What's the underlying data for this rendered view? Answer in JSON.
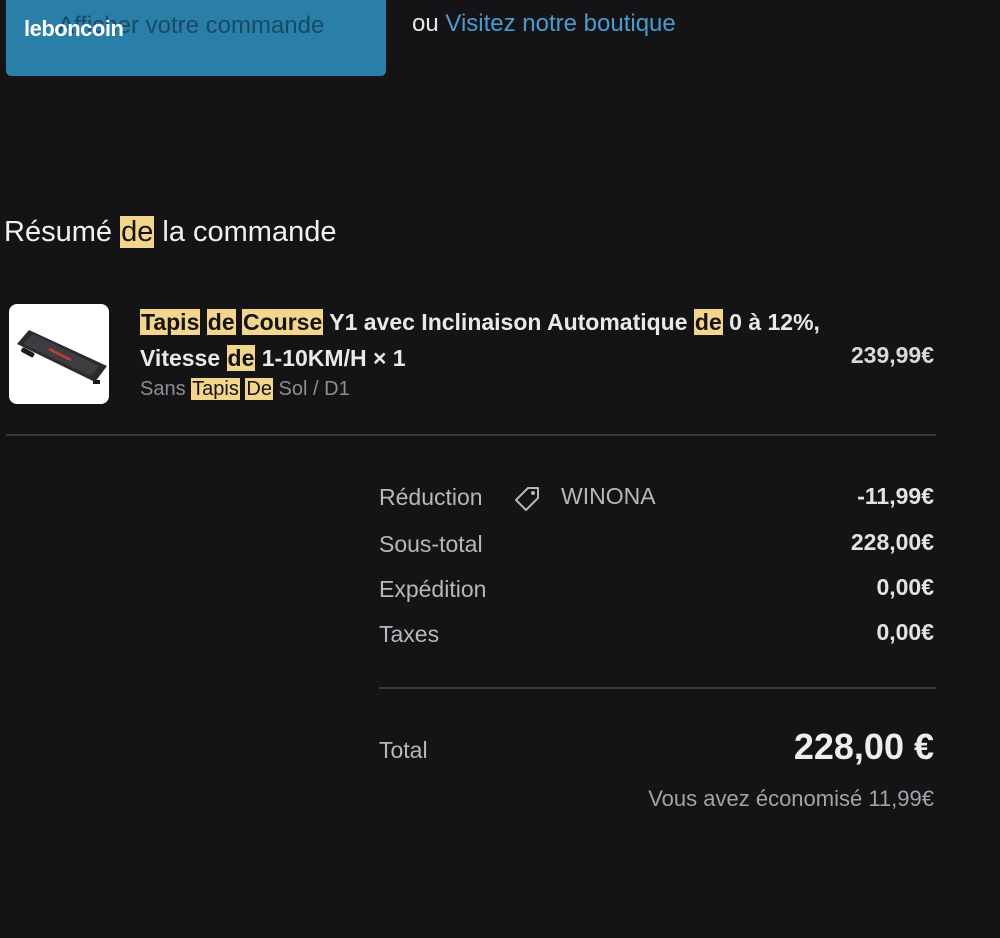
{
  "header": {
    "order_button_label": "Afficher votre commande",
    "brand": "leboncoin",
    "or_text": "ou",
    "shop_link": "Visitez notre boutique"
  },
  "summary": {
    "title_before": "Résumé",
    "title_highlight": "de",
    "title_after": "la commande"
  },
  "product": {
    "name_parts": {
      "p1": "Tapis",
      "p2": "de",
      "p3": "Course",
      "p4": " Y1 avec Inclinaison Automatique ",
      "p5": "de",
      "p6": " 0 à 12%, Vitesse ",
      "p7": "de",
      "p8": " 1-10KM/H × 1"
    },
    "variant_parts": {
      "v1": "Sans ",
      "v2": "Tapis",
      "v3": "De",
      "v4": " Sol / D1"
    },
    "price": "239,99€",
    "image_icon": "treadmill-image"
  },
  "totals": {
    "discount_label": "Réduction",
    "discount_icon": "tag-icon",
    "discount_code": "WINONA",
    "discount_value": "-11,99€",
    "subtotal_label": "Sous-total",
    "subtotal_value": "228,00€",
    "shipping_label": "Expédition",
    "shipping_value": "0,00€",
    "taxes_label": "Taxes",
    "taxes_value": "0,00€",
    "total_label": "Total",
    "total_value": "228,00 €",
    "savings_text": "Vous avez économisé 11,99€"
  },
  "colors": {
    "background": "#141416",
    "button": "#2a7fa8",
    "link": "#4a9bd1",
    "highlight": "#f3d68c"
  }
}
